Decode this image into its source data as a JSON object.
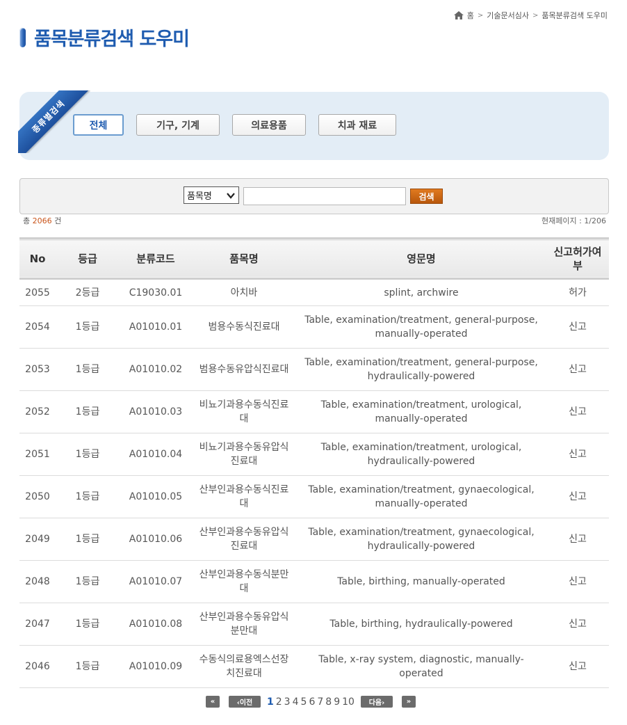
{
  "breadcrumb": {
    "home": "홈",
    "section": "기술문서심사",
    "current": "품목분류검색 도우미"
  },
  "page_title": "품목분류검색 도우미",
  "category": {
    "ribbon_label": "종류별검색",
    "buttons": [
      "전체",
      "기구, 기계",
      "의료용품",
      "치과 재료"
    ],
    "active_index": 0
  },
  "search": {
    "select_value": "품목명",
    "input_value": "",
    "button_label": "검색"
  },
  "summary": {
    "total_prefix": "총",
    "total_count": "2066",
    "total_suffix": "건",
    "current_page": "현재페이지 : 1/206"
  },
  "table": {
    "headers": [
      "No",
      "등급",
      "분류코드",
      "품목명",
      "영문명",
      "신고허가여부"
    ],
    "rows": [
      {
        "no": "2055",
        "grade": "2등급",
        "code": "C19030.01",
        "name": "아치바",
        "en": "splint, archwire",
        "type": "허가"
      },
      {
        "no": "2054",
        "grade": "1등급",
        "code": "A01010.01",
        "name": "범용수동식진료대",
        "en": "Table, examination/treatment, general-purpose, manually-operated",
        "type": "신고"
      },
      {
        "no": "2053",
        "grade": "1등급",
        "code": "A01010.02",
        "name": "범용수동유압식진료대",
        "en": "Table, examination/treatment, general-purpose, hydraulically-powered",
        "type": "신고"
      },
      {
        "no": "2052",
        "grade": "1등급",
        "code": "A01010.03",
        "name": "비뇨기과용수동식진료대",
        "en": "Table, examination/treatment, urological, manually-operated",
        "type": "신고"
      },
      {
        "no": "2051",
        "grade": "1등급",
        "code": "A01010.04",
        "name": "비뇨기과용수동유압식진료대",
        "en": "Table, examination/treatment, urological, hydraulically-powered",
        "type": "신고"
      },
      {
        "no": "2050",
        "grade": "1등급",
        "code": "A01010.05",
        "name": "산부인과용수동식진료대",
        "en": "Table, examination/treatment, gynaecological, manually-operated",
        "type": "신고"
      },
      {
        "no": "2049",
        "grade": "1등급",
        "code": "A01010.06",
        "name": "산부인과용수동유압식진료대",
        "en": "Table, examination/treatment, gynaecological, hydraulically-powered",
        "type": "신고"
      },
      {
        "no": "2048",
        "grade": "1등급",
        "code": "A01010.07",
        "name": "산부인과용수동식분만대",
        "en": "Table, birthing, manually-operated",
        "type": "신고"
      },
      {
        "no": "2047",
        "grade": "1등급",
        "code": "A01010.08",
        "name": "산부인과용수동유압식분만대",
        "en": "Table, birthing, hydraulically-powered",
        "type": "신고"
      },
      {
        "no": "2046",
        "grade": "1등급",
        "code": "A01010.09",
        "name": "수동식의료용엑스선장치진료대",
        "en": "Table, x-ray system, diagnostic, manually-operated",
        "type": "신고"
      }
    ]
  },
  "pagination": {
    "first": "«",
    "prev": "‹이전",
    "pages": [
      "1",
      "2",
      "3",
      "4",
      "5",
      "6",
      "7",
      "8",
      "9",
      "10"
    ],
    "current": "1",
    "next": "다음›",
    "last": "»"
  }
}
